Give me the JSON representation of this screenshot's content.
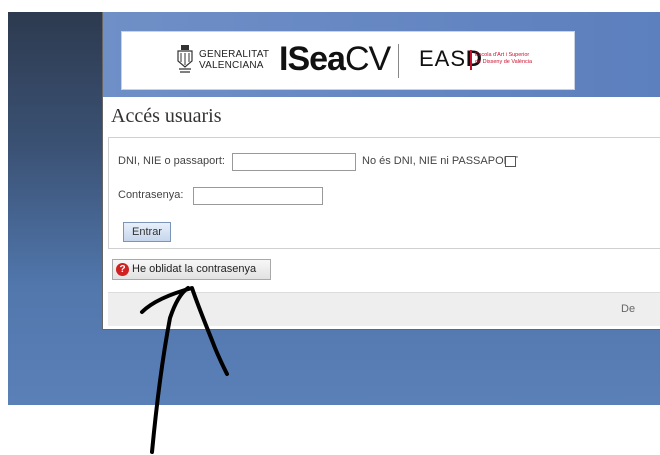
{
  "header": {
    "gen_line1": "GENERALITAT",
    "gen_line2": "VALENCIANA",
    "iseacv_bold": "ISea",
    "iseacv_light": "CV",
    "easd_light": "EAS",
    "easd_bold": "D",
    "easd_sub1": "Escola d'Art i Superior",
    "easd_sub2": "de Disseny de València"
  },
  "page": {
    "title": "Accés usuaris"
  },
  "form": {
    "id_label": "DNI, NIE o passaport:",
    "id_value": "",
    "no_id_label": "No és DNI, NIE ni PASSAPORT",
    "password_label": "Contrasenya:",
    "password_value": "",
    "submit_label": "Entrar"
  },
  "forgot": {
    "label": "He oblidat la contrasenya",
    "icon": "help-icon"
  },
  "footer": {
    "text": "De"
  },
  "colors": {
    "header_blue": "#5c7fbd",
    "button_blue": "#c6d6ec",
    "help_red": "#d21f1f",
    "annotation": "#000000"
  }
}
